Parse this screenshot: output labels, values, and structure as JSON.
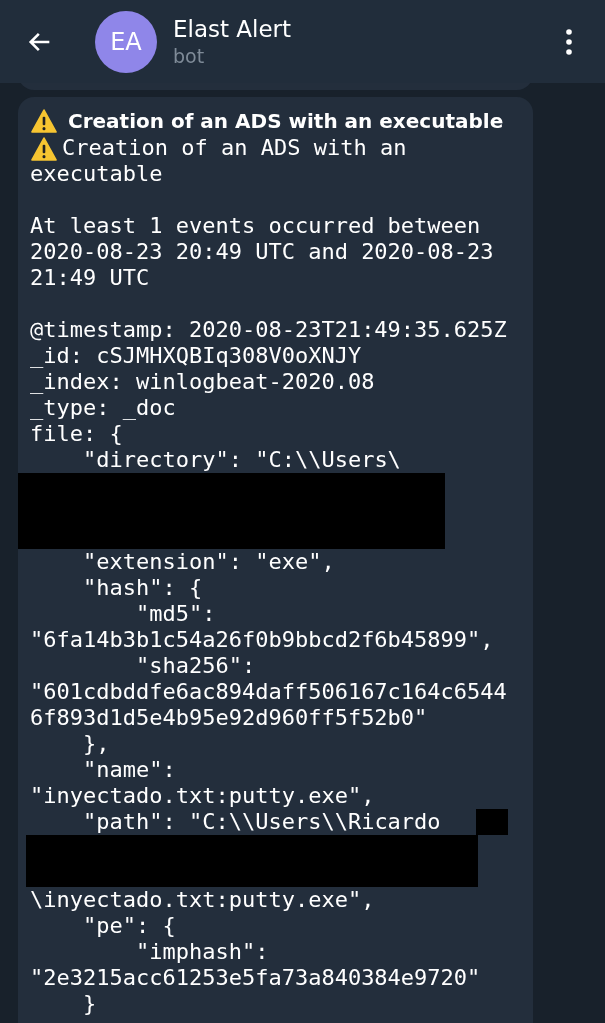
{
  "header": {
    "avatar_initials": "EA",
    "title": "Elast Alert",
    "subtitle": "bot"
  },
  "message": {
    "title": "Creation of an ADS with an executable",
    "blocks": [
      {
        "kind": "warning",
        "text": "Creation of an ADS with an"
      },
      {
        "kind": "text",
        "text": "executable"
      },
      {
        "kind": "blank"
      },
      {
        "kind": "text",
        "text": "At least 1 events occurred between 2020-08-23 20:49 UTC and 2020-08-23 21:49 UTC"
      },
      {
        "kind": "blank"
      },
      {
        "kind": "text",
        "text": "@timestamp: 2020-08-23T21:49:35.625Z"
      },
      {
        "kind": "text",
        "text": "_id: cSJMHXQBIq308V0oXNJY"
      },
      {
        "kind": "text",
        "text": "_index: winlogbeat-2020.08"
      },
      {
        "kind": "text",
        "text": "_type: _doc"
      },
      {
        "kind": "text",
        "text": "file: {"
      },
      {
        "kind": "text",
        "text": "    \"directory\": \"C:\\\\Users\\"
      },
      {
        "kind": "redaction"
      },
      {
        "kind": "text",
        "text": "    \"extension\": \"exe\","
      },
      {
        "kind": "text",
        "text": "    \"hash\": {"
      },
      {
        "kind": "text",
        "text": "        \"md5\":"
      },
      {
        "kind": "text",
        "text": "\"6fa14b3b1c54a26f0b9bbcd2f6b45899\","
      },
      {
        "kind": "text",
        "text": "        \"sha256\":"
      },
      {
        "kind": "text",
        "text": "\"601cdbddfe6ac894daff506167c164c6544"
      },
      {
        "kind": "text",
        "text": "6f893d1d5e4b95e92d960ff5f52b0\""
      },
      {
        "kind": "text",
        "text": "    },"
      },
      {
        "kind": "text",
        "text": "    \"name\":"
      },
      {
        "kind": "text",
        "text": "\"inyectado.txt:putty.exe\","
      },
      {
        "kind": "redacted_tail",
        "text": "    \"path\": \"C:\\\\Users\\\\Ricardo"
      },
      {
        "kind": "text",
        "text": "\\inyectado.txt:putty.exe\","
      },
      {
        "kind": "text",
        "text": "    \"pe\": {"
      },
      {
        "kind": "text",
        "text": "        \"imphash\":"
      },
      {
        "kind": "text",
        "text": "\"2e3215acc61253e5fa73a840384e9720\""
      },
      {
        "kind": "text",
        "text": "    }"
      }
    ]
  }
}
